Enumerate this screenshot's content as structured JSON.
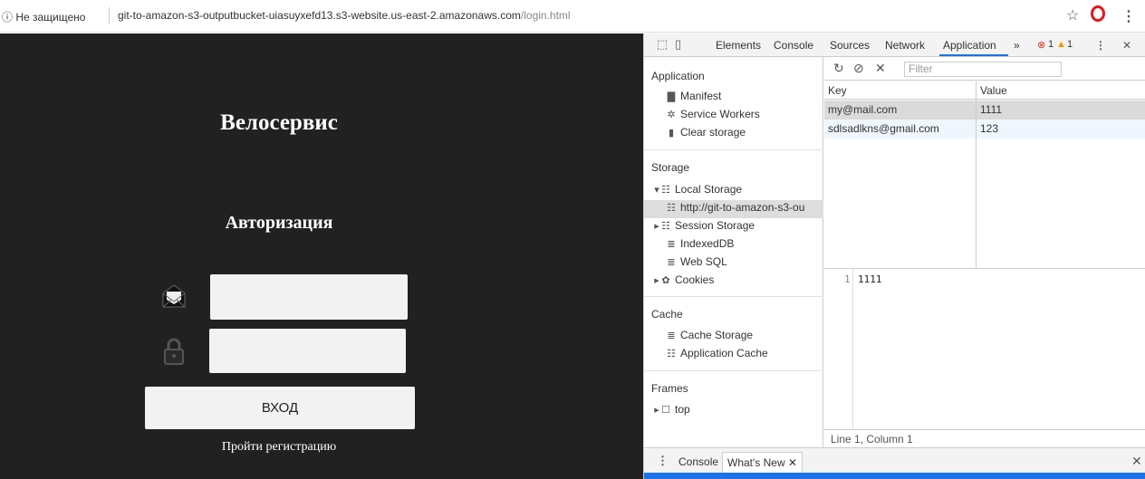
{
  "addressbar": {
    "security_label": "ⓘ Не защищено",
    "url_host": "git-to-amazon-s3-outputbucket-uiasuyxefd13.s3-website.us-east-2.amazonaws.com",
    "url_path": "/login.html"
  },
  "page": {
    "title": "Велосервис",
    "auth_title": "Авторизация",
    "login_button": "ВХОД",
    "register_link": "Пройти регистрацию"
  },
  "devtools": {
    "tabs": [
      "Elements",
      "Console",
      "Sources",
      "Network",
      "Application"
    ],
    "active_tab": "Application",
    "more_tabs": "»",
    "errors": "1",
    "warnings": "1",
    "close": "✕",
    "sidebar": {
      "application_header": "Application",
      "application_items": [
        "Manifest",
        "Service Workers",
        "Clear storage"
      ],
      "storage_header": "Storage",
      "local_storage": "Local Storage",
      "local_storage_origin": "http://git-to-amazon-s3-ou",
      "session_storage": "Session Storage",
      "indexeddb": "IndexedDB",
      "websql": "Web SQL",
      "cookies": "Cookies",
      "cache_header": "Cache",
      "cache_storage": "Cache Storage",
      "application_cache": "Application Cache",
      "frames_header": "Frames",
      "frames_top": "top"
    },
    "filter_placeholder": "Filter",
    "table": {
      "col_key": "Key",
      "col_value": "Value",
      "rows": [
        {
          "key": "my@mail.com",
          "value": "1111"
        },
        {
          "key": "sdlsadlkns@gmail.com",
          "value": "123"
        }
      ]
    },
    "preview": {
      "line_number": "1",
      "content": "1111"
    },
    "status": "Line 1, Column 1",
    "drawer": {
      "tabs": [
        "Console",
        "What's New"
      ],
      "active": "What's New"
    }
  }
}
